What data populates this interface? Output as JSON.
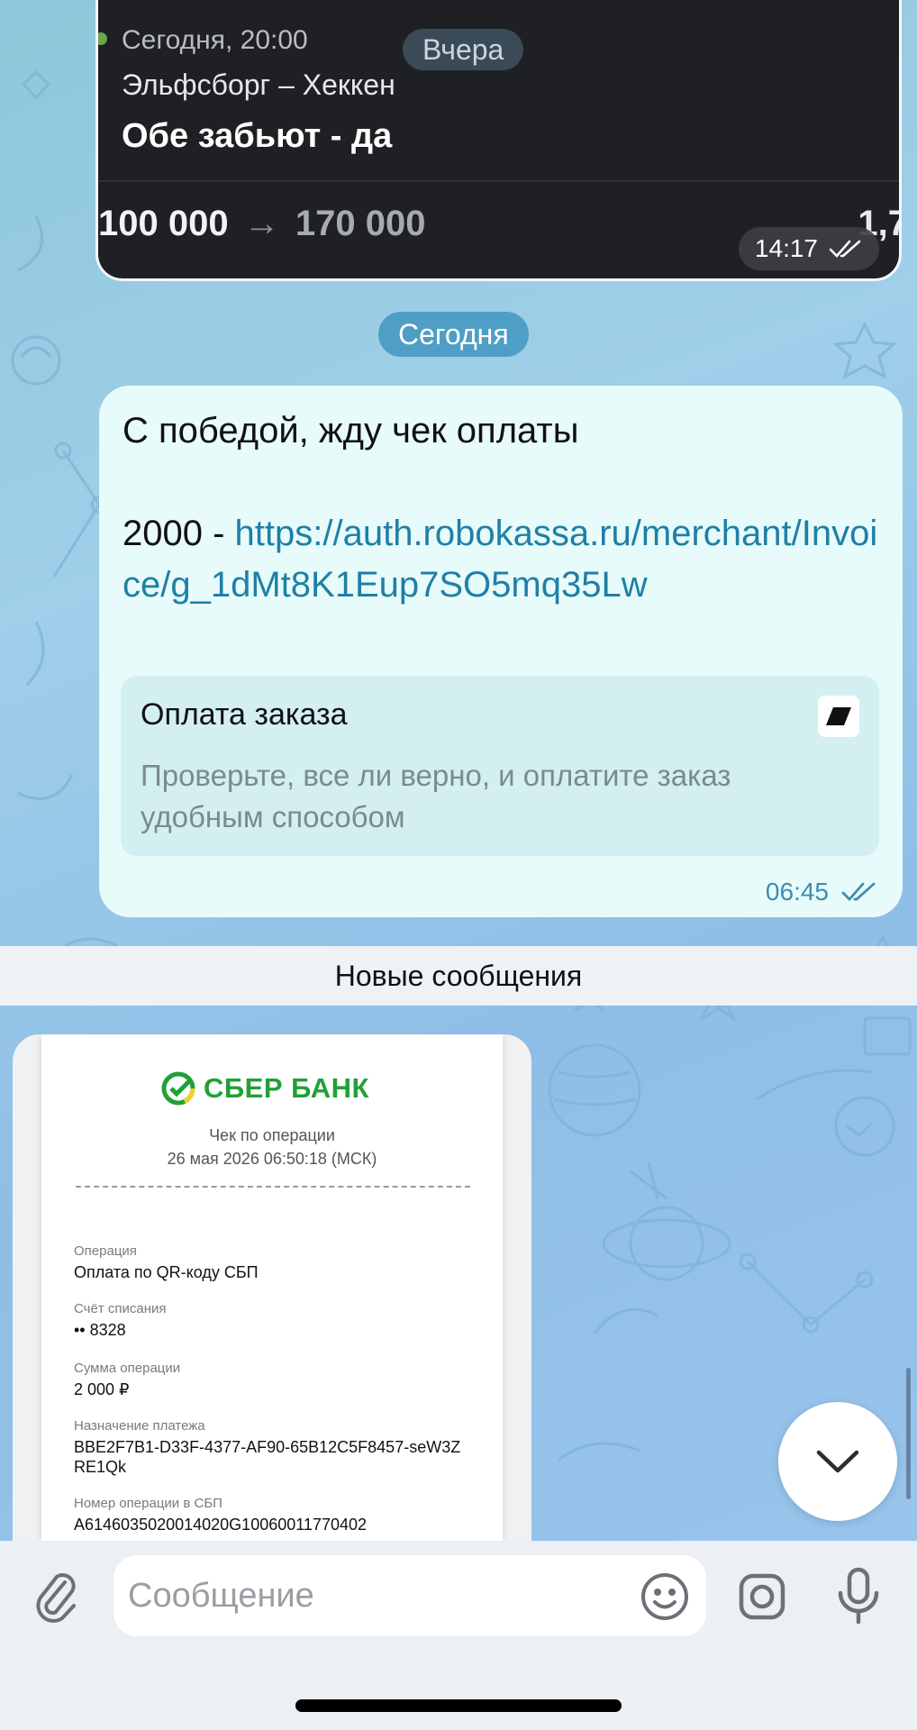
{
  "colors": {
    "wallpaper": "#9fcfe9",
    "bubble_in": "#e8fbfb",
    "bubble_dark": "#1f2023",
    "link": "#1e80a6",
    "sber_green": "#21a038",
    "time_blue": "#3d8db0"
  },
  "bet_message": {
    "datetime": "Сегодня, 20:00",
    "day_separator": "Вчера",
    "match": "Эльфсборг – Хеккен",
    "outcome": "Обе забьют - да",
    "stake": "100 000",
    "payout": "170 000",
    "odds": "1,7",
    "time": "14:17",
    "status_icon": "double-check-icon"
  },
  "day_separator_today": "Сегодня",
  "message": {
    "line1": "С победой, жду чек оплаты",
    "amount_prefix": "2000 - ",
    "link": "https://auth.robokassa.ru/merchant/Invoice/g_1dMt8K1Eup7SO5mq35Lw",
    "preview": {
      "title": "Оплата заказа",
      "description": "Проверьте, все ли верно, и оплатите заказ удобным способом",
      "icon": "robokassa-logo-icon"
    },
    "time": "06:45",
    "status_icon": "double-check-icon"
  },
  "new_messages_label": "Новые сообщения",
  "receipt": {
    "bank": "СБЕР БАНК",
    "subtitle": "Чек по операции",
    "datetime": "26 мая 2026 06:50:18 (МСК)",
    "fields": [
      {
        "label": "Операция",
        "value": "Оплата по QR-коду СБП"
      },
      {
        "label": "Счёт списания",
        "value": "•• 8328"
      },
      {
        "label": "Сумма операции",
        "value": "2 000 ₽"
      },
      {
        "label": "Назначение платежа",
        "value": "BBE2F7B1-D33F-4377-AF90-65B12C5F8457-seW3ZRE1Qk"
      },
      {
        "label": "Номер операции в СБП",
        "value": "A6146035020014020G10060011770402"
      }
    ]
  },
  "input": {
    "placeholder": "Сообщение",
    "attach_icon": "paperclip-icon",
    "emoji_icon": "emoji-icon",
    "camera_icon": "camera-icon",
    "mic_icon": "microphone-icon"
  },
  "scroll_button_icon": "chevron-down-icon"
}
